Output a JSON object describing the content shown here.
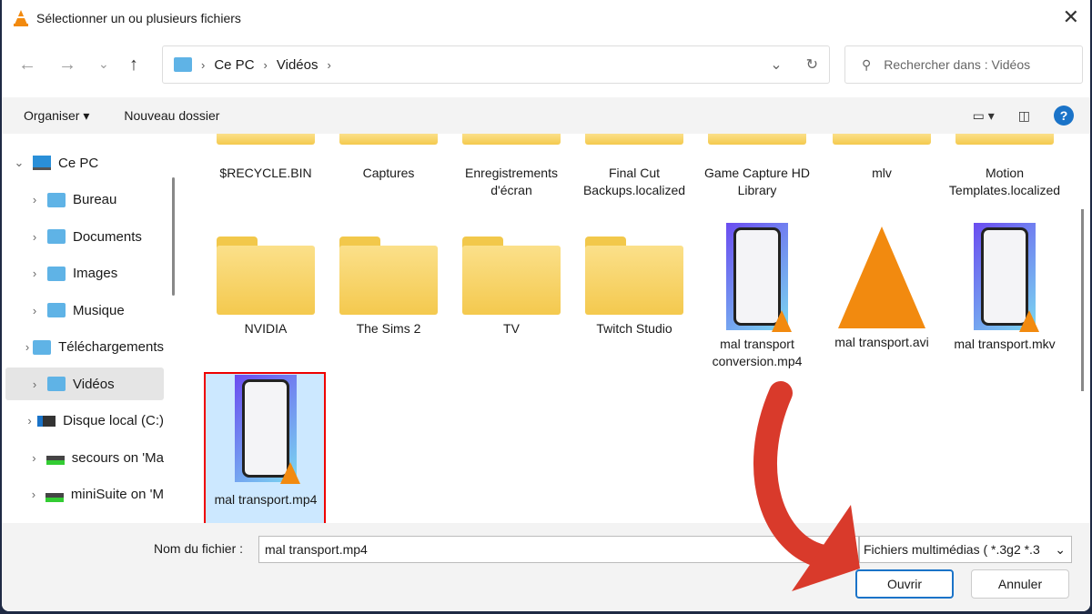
{
  "window": {
    "title": "Sélectionner un ou plusieurs fichiers",
    "close": "✕"
  },
  "nav": {
    "back": "←",
    "forward": "→",
    "recent": "⌄",
    "up": "↑",
    "breadcrumb": [
      "Ce PC",
      "Vidéos"
    ],
    "search_placeholder": "Rechercher dans : Vidéos"
  },
  "toolbar": {
    "organize": "Organiser ▾",
    "new_folder": "Nouveau dossier",
    "help": "?"
  },
  "sidebar": {
    "items": [
      {
        "label": "Ce PC",
        "icon": "pc-icon",
        "expanded": true
      },
      {
        "label": "Bureau",
        "icon": "folder-icon"
      },
      {
        "label": "Documents",
        "icon": "folder-icon"
      },
      {
        "label": "Images",
        "icon": "folder-icon"
      },
      {
        "label": "Musique",
        "icon": "folder-icon"
      },
      {
        "label": "Téléchargements",
        "icon": "folder-icon"
      },
      {
        "label": "Vidéos",
        "icon": "folder-icon",
        "selected": true
      },
      {
        "label": "Disque local (C:)",
        "icon": "drive-icon"
      },
      {
        "label": "secours on 'Ma",
        "icon": "network-drive-icon"
      },
      {
        "label": "miniSuite on 'M",
        "icon": "network-drive-icon"
      }
    ]
  },
  "files": [
    {
      "name": "$RECYCLE.BIN",
      "type": "folder"
    },
    {
      "name": "Captures",
      "type": "folder"
    },
    {
      "name": "Enregistrements d'écran",
      "type": "folder"
    },
    {
      "name": "Final Cut Backups.localized",
      "type": "folder"
    },
    {
      "name": "Game Capture HD Library",
      "type": "folder"
    },
    {
      "name": "mlv",
      "type": "folder"
    },
    {
      "name": "Motion Templates.localized",
      "type": "folder"
    },
    {
      "name": "NVIDIA",
      "type": "folder"
    },
    {
      "name": "The Sims 2",
      "type": "folder"
    },
    {
      "name": "TV",
      "type": "folder"
    },
    {
      "name": "Twitch Studio",
      "type": "folder"
    },
    {
      "name": "mal transport conversion.mp4",
      "type": "video"
    },
    {
      "name": "mal transport.avi",
      "type": "vlc"
    },
    {
      "name": "mal transport.mkv",
      "type": "video"
    },
    {
      "name": "mal transport.mp4",
      "type": "video",
      "selected": true
    }
  ],
  "footer": {
    "filename_label": "Nom du fichier :",
    "filename_value": "mal transport.mp4",
    "filetype": "Fichiers multimédias ( *.3g2 *.3",
    "open": "Ouvrir",
    "cancel": "Annuler"
  },
  "colors": {
    "accent": "#1a73c8",
    "selection": "#cce8ff",
    "highlight_border": "#e00000",
    "arrow": "#d93a2b"
  }
}
